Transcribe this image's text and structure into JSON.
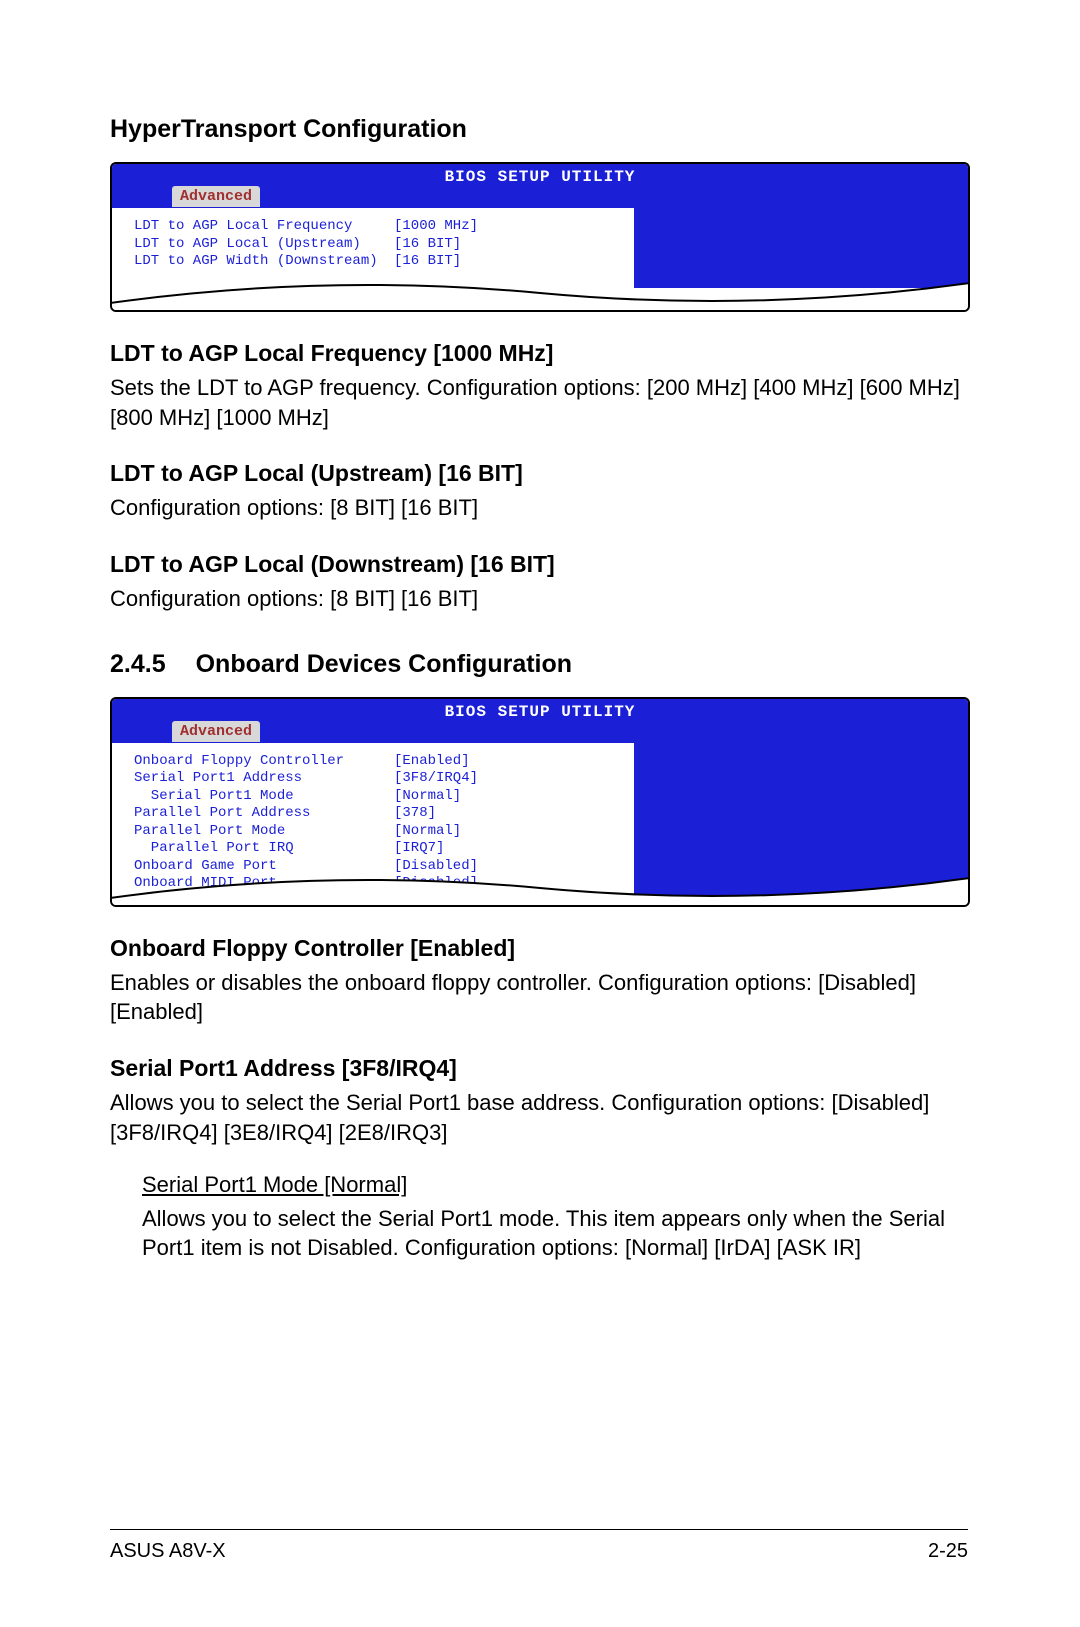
{
  "section1": {
    "title": "HyperTransport Configuration"
  },
  "bios1": {
    "header": "BIOS SETUP UTILITY",
    "tab": "Advanced",
    "rows": [
      {
        "label": "LDT to AGP Local Frequency",
        "value": "[1000 MHz]"
      },
      {
        "label": "LDT to AGP Local (Upstream)",
        "value": "[16 BIT]"
      },
      {
        "label": "LDT to AGP Width (Downstream)",
        "value": "[16 BIT]"
      }
    ]
  },
  "item1": {
    "heading": "LDT to AGP Local Frequency [1000 MHz]",
    "body": "Sets the LDT to AGP frequency. Configuration options: [200 MHz] [400 MHz] [600 MHz] [800 MHz] [1000 MHz]"
  },
  "item2": {
    "heading": "LDT to AGP Local (Upstream) [16 BIT]",
    "body": "Configuration options: [8 BIT] [16 BIT]"
  },
  "item3": {
    "heading": "LDT to AGP Local (Downstream) [16 BIT]",
    "body": "Configuration options: [8 BIT] [16 BIT]"
  },
  "section2": {
    "number": "2.4.5",
    "title": "Onboard Devices Configuration"
  },
  "bios2": {
    "header": "BIOS SETUP UTILITY",
    "tab": "Advanced",
    "rows": [
      {
        "label": "Onboard Floppy Controller",
        "value": "[Enabled]"
      },
      {
        "label": "Serial Port1 Address",
        "value": "[3F8/IRQ4]"
      },
      {
        "label": "  Serial Port1 Mode",
        "value": "[Normal]"
      },
      {
        "label": "Parallel Port Address",
        "value": "[378]"
      },
      {
        "label": "Parallel Port Mode",
        "value": "[Normal]"
      },
      {
        "label": "  Parallel Port IRQ",
        "value": "[IRQ7]"
      },
      {
        "label": "Onboard Game Port",
        "value": "[Disabled]"
      },
      {
        "label": "Onboard MIDI Port",
        "value": "[Disabled]"
      }
    ]
  },
  "item4": {
    "heading": "Onboard Floppy Controller [Enabled]",
    "body": "Enables or disables the onboard floppy controller. Configuration options: [Disabled] [Enabled]"
  },
  "item5": {
    "heading": "Serial Port1 Address [3F8/IRQ4]",
    "body": "Allows you to select the Serial Port1 base address. Configuration options: [Disabled] [3F8/IRQ4] [3E8/IRQ4] [2E8/IRQ3]"
  },
  "item6": {
    "heading": "Serial Port1 Mode [Normal]",
    "body": "Allows you to select the Serial Port1 mode. This item appears only when the Serial Port1 item is not Disabled. Configuration options: [Normal] [IrDA] [ASK IR]"
  },
  "footer": {
    "left": "ASUS A8V-X",
    "right": "2-25"
  }
}
